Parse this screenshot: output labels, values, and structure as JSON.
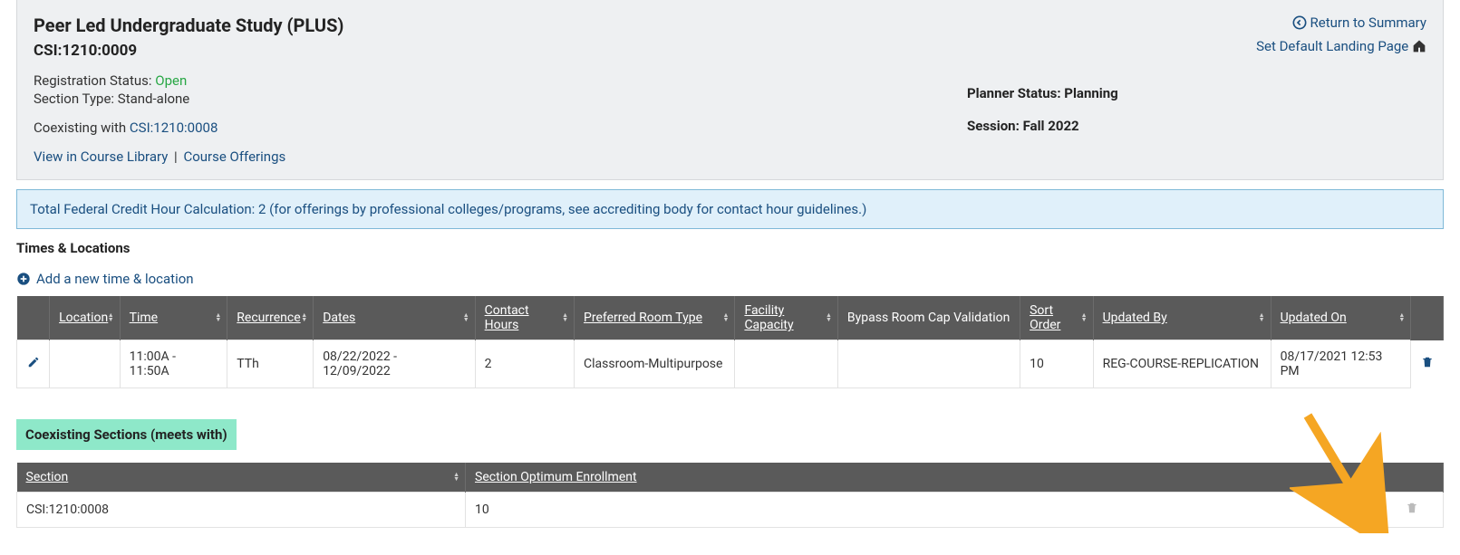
{
  "header": {
    "course_title": "Peer Led Undergraduate Study (PLUS)",
    "course_code": "CSI:1210:0009",
    "reg_status_label": "Registration Status:",
    "reg_status_value": "Open",
    "section_type_label": "Section Type:",
    "section_type_value": "Stand-alone",
    "coexisting_label": "Coexisting with",
    "coexisting_link": "CSI:1210:0008",
    "view_lib": "View in Course Library",
    "course_off": "Course Offerings",
    "return_link": "Return to Summary",
    "default_landing": "Set Default Landing Page",
    "planner_status_label": "Planner Status:",
    "planner_status_value": "Planning",
    "session_label": "Session:",
    "session_value": "Fall 2022"
  },
  "info_banner_prefix": "Total Federal Credit Hour Calculation: ",
  "info_banner_value": "2",
  "info_banner_suffix": " (for offerings by professional colleges/programs, see accrediting body for contact hour guidelines.)",
  "times_heading": "Times & Locations",
  "add_time_label": "Add a new time & location",
  "times_table": {
    "headers": {
      "location": "Location",
      "time": "Time",
      "recurrence": "Recurrence",
      "dates": "Dates",
      "contact_hours": "Contact Hours",
      "preferred_room": "Preferred Room Type",
      "facility_capacity": "Facility Capacity",
      "bypass": "Bypass Room Cap Validation",
      "sort_order": "Sort Order",
      "updated_by": "Updated By",
      "updated_on": "Updated On"
    },
    "row": {
      "location": "",
      "time": "11:00A - 11:50A",
      "recurrence": "TTh",
      "dates": "08/22/2022 - 12/09/2022",
      "contact_hours": "2",
      "preferred_room": "Classroom-Multipurpose",
      "facility_capacity": "",
      "bypass": "",
      "sort_order": "10",
      "updated_by": "REG-COURSE-REPLICATION",
      "updated_on": "08/17/2021 12:53 PM"
    }
  },
  "coexist_heading": "Coexisting Sections (meets with)",
  "coexist_table": {
    "headers": {
      "section": "Section",
      "opt_enroll": "Section Optimum Enrollment"
    },
    "row": {
      "section": "CSI:1210:0008",
      "opt_enroll": "10"
    }
  }
}
